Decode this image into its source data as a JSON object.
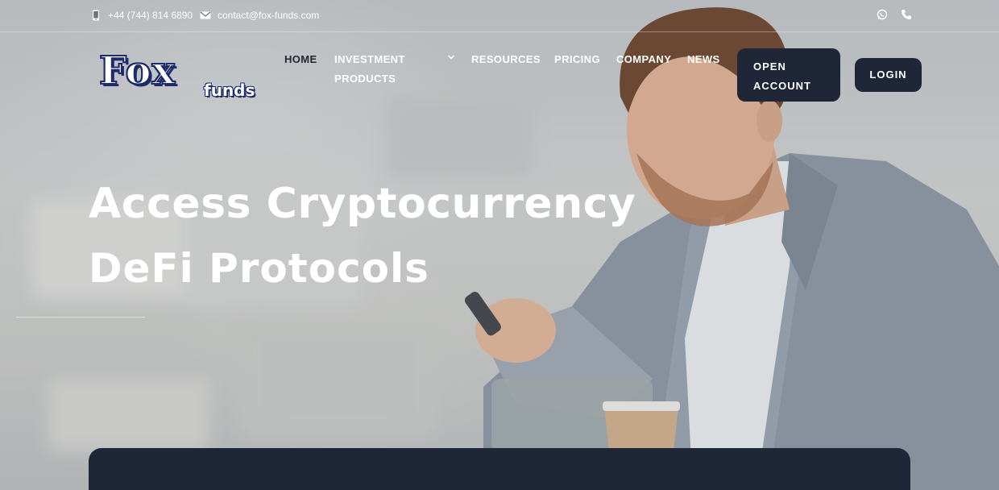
{
  "topbar": {
    "phone": "+44 (744) 814 6890",
    "email": "contact@fox-funds.com",
    "social_icons": [
      "whatsapp-icon",
      "phone-icon"
    ]
  },
  "logo": {
    "primary": "Fox",
    "secondary": "funds"
  },
  "nav": {
    "items": [
      {
        "label": "HOME"
      },
      {
        "label": "INVESTMENT PRODUCTS"
      },
      {
        "label": "RESOURCES"
      },
      {
        "label": "PRICING"
      },
      {
        "label": "COMPANY"
      },
      {
        "label": "NEWS"
      }
    ],
    "open_account": "OPEN ACCOUNT",
    "login": "LOGIN"
  },
  "hero": {
    "line1": "Access Cryptocurrency",
    "line2": "DeFi Protocols"
  },
  "colors": {
    "navy": "#1e2638",
    "brand_blue": "#1d2a6b",
    "white": "#ffffff"
  }
}
